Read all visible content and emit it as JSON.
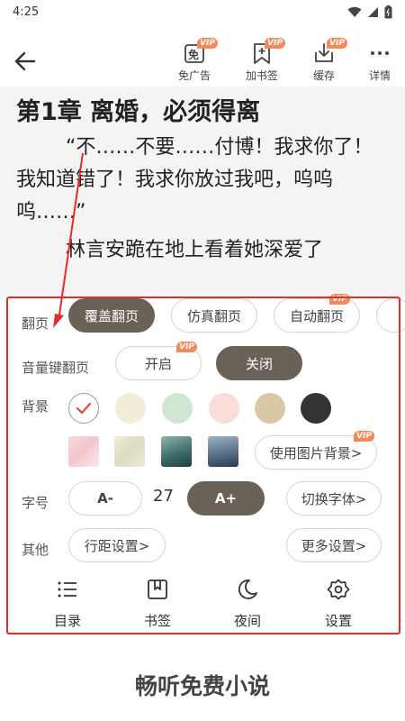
{
  "status_bar": {
    "time": "4:25"
  },
  "toolbar": {
    "tools": [
      {
        "label": "免广告",
        "icon": "ad-free-icon",
        "icon_text": "免",
        "vip": "VIP"
      },
      {
        "label": "加书签",
        "icon": "add-bookmark-icon",
        "vip": "VIP"
      },
      {
        "label": "缓存",
        "icon": "download-cache-icon",
        "vip": "VIP"
      },
      {
        "label": "详情",
        "icon": "more-dots-icon"
      }
    ]
  },
  "reader": {
    "chapter_title": "第1章 离婚，必须得离",
    "paragraphs": [
      "“不……不要……付博！我求你了！我知道错了！我求你放过我吧，呜呜呜……”",
      "林言安跪在地上看着她深爱了"
    ]
  },
  "settings": {
    "page_turn": {
      "label": "翻页",
      "options": [
        {
          "label": "覆盖翻页",
          "active": true
        },
        {
          "label": "仿真翻页",
          "active": false
        },
        {
          "label": "自动翻页",
          "active": false,
          "vip": "VIP"
        }
      ]
    },
    "volume_key": {
      "label": "音量键翻页",
      "on_label": "开启",
      "off_label": "关闭",
      "vip": "VIP",
      "selected": "off"
    },
    "background": {
      "label": "背景",
      "colors": [
        "#ffffff",
        "#f3ecd8",
        "#cfe6d2",
        "#fadddb",
        "#d9c7a5",
        "#333333"
      ],
      "selected_index": 0,
      "image_button": "使用图片背景>",
      "image_vip": "VIP"
    },
    "font_size": {
      "label": "字号",
      "decrease": "A-",
      "value": "27",
      "increase": "A+",
      "switch_font": "切换字体>"
    },
    "other": {
      "label": "其他",
      "line_spacing": "行距设置>",
      "more": "更多设置>"
    }
  },
  "bottom_nav": [
    {
      "label": "目录",
      "icon": "list-icon"
    },
    {
      "label": "书签",
      "icon": "bookmark-icon"
    },
    {
      "label": "夜间",
      "icon": "moon-icon"
    },
    {
      "label": "设置",
      "icon": "gear-icon"
    }
  ],
  "promo": {
    "text": "畅听免费小说"
  },
  "colors": {
    "accent_dark": "#6b6257",
    "vip_orange": "#f48a5a",
    "annotation_red": "#e52b2b"
  }
}
